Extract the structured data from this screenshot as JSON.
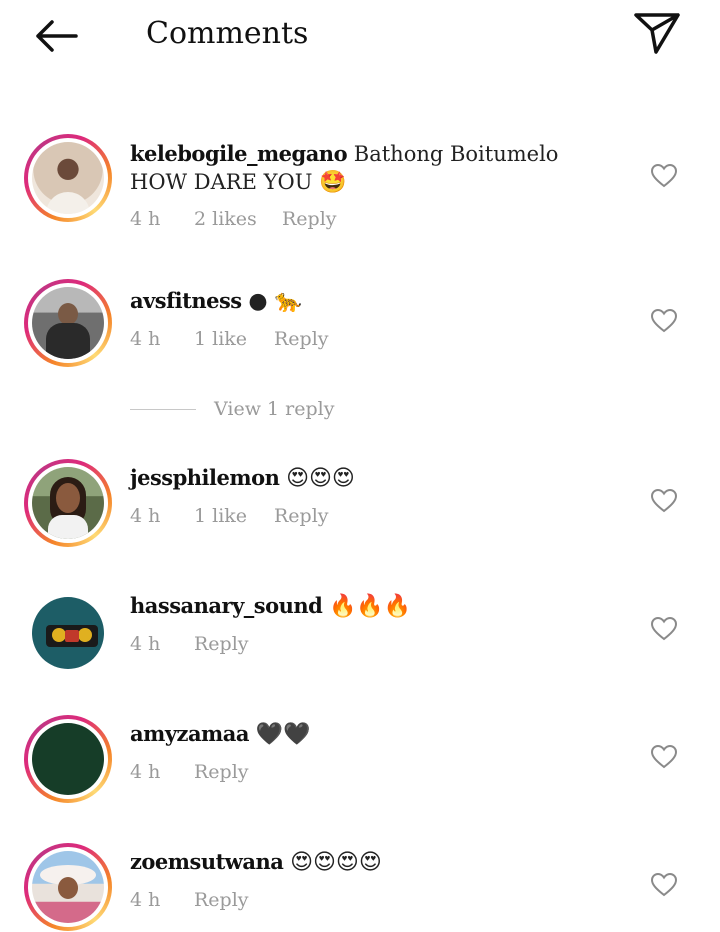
{
  "header": {
    "title": "Comments",
    "back_icon": "arrow-left-icon",
    "send_icon": "paper-plane-icon"
  },
  "colors": {
    "ring_start": "#f58529",
    "ring_end": "#dd2a7b",
    "muted_text": "#9a9a9a"
  },
  "comments": [
    {
      "username": "kelebogile_megano",
      "text": "Bathong Boitumelo HOW DARE YOU",
      "emoji": "🤩",
      "time": "4 h",
      "likes": "2 likes",
      "reply": "Reply"
    },
    {
      "username": "avsfitness",
      "text": "",
      "emoji": "● 🐆",
      "time": "4 h",
      "likes": "1 like",
      "reply": "Reply"
    },
    {
      "username": "jessphilemon",
      "text": "",
      "emoji": "😍😍😍",
      "time": "4 h",
      "likes": "1 like",
      "reply": "Reply"
    },
    {
      "username": "hassanary_sound",
      "text": "",
      "emoji": "🔥🔥🔥",
      "time": "4 h",
      "likes": "",
      "reply": "Reply"
    },
    {
      "username": "amyzamaa",
      "text": "",
      "emoji": "🖤🖤",
      "time": "4 h",
      "likes": "",
      "reply": "Reply"
    },
    {
      "username": "zoemsutwana",
      "text": "",
      "emoji": "😍😍😍😍",
      "time": "4 h",
      "likes": "",
      "reply": "Reply"
    }
  ],
  "view_replies": {
    "label": "View 1 reply"
  }
}
